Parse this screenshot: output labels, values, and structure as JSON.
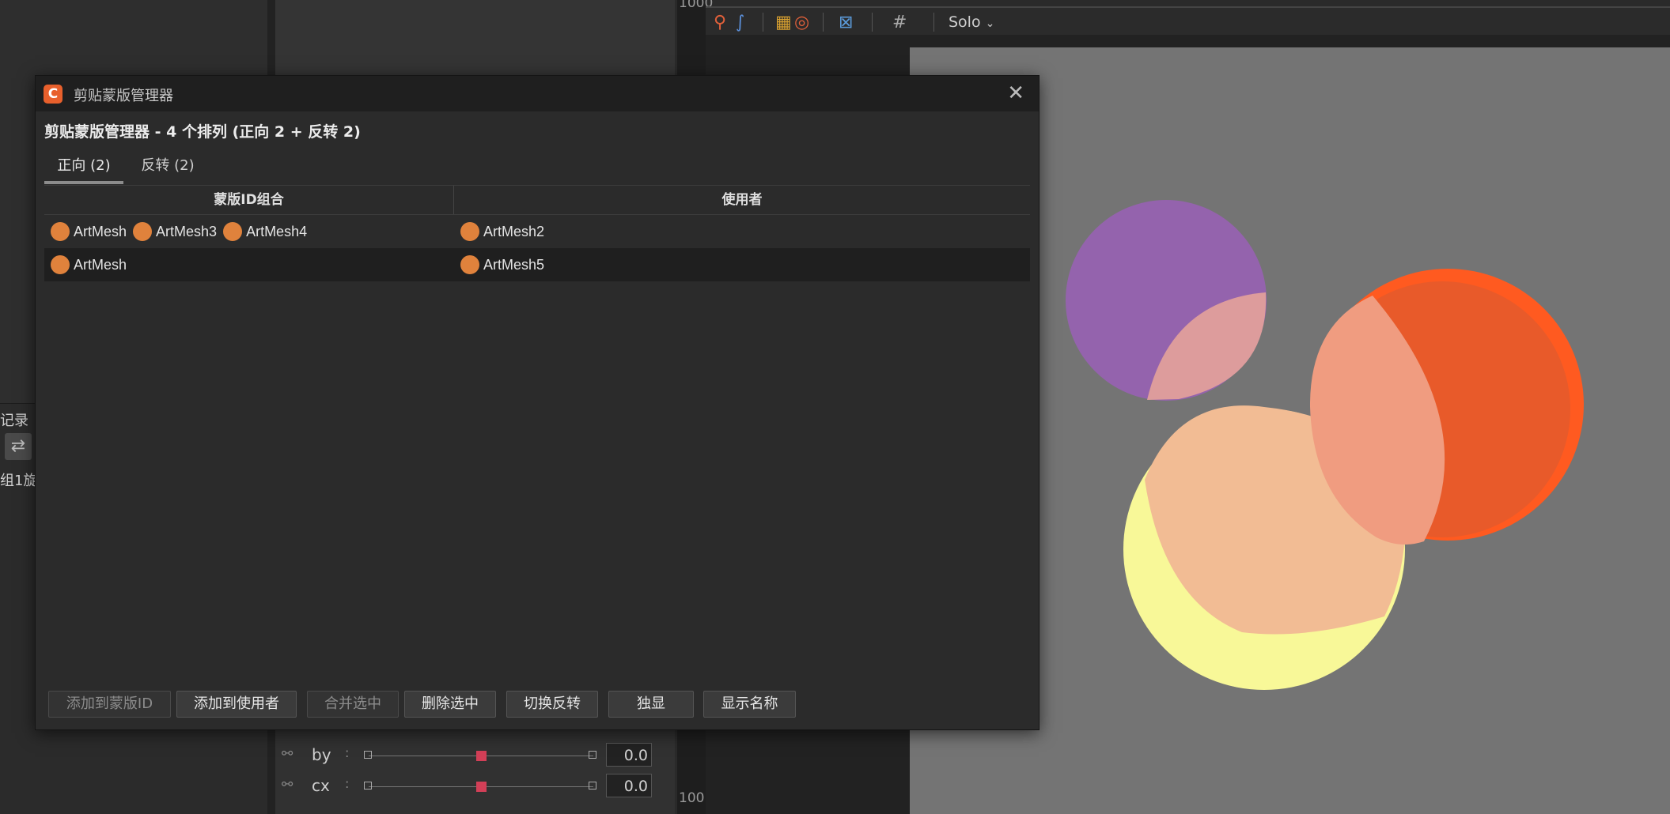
{
  "background": {
    "left_labels": [
      "记录",
      "组1旋"
    ],
    "ruler_labels": [
      "1000",
      "100"
    ],
    "toolbar": {
      "solo_label": "Solo"
    },
    "params": [
      {
        "name": "by",
        "value": "0.0"
      },
      {
        "name": "cx",
        "value": "0.0"
      }
    ]
  },
  "dialog": {
    "title": "剪贴蒙版管理器",
    "heading": "剪贴蒙版管理器 - 4 个排列 (正向 2 + 反转 2)",
    "tabs": [
      {
        "label": "正向 (2)",
        "active": true
      },
      {
        "label": "反转 (2)",
        "active": false
      }
    ],
    "columns": [
      "蒙版ID组合",
      "使用者"
    ],
    "rows": [
      {
        "masks": [
          "ArtMesh",
          "ArtMesh3",
          "ArtMesh4"
        ],
        "users": [
          "ArtMesh2"
        ]
      },
      {
        "masks": [
          "ArtMesh"
        ],
        "users": [
          "ArtMesh5"
        ]
      }
    ],
    "buttons": [
      {
        "label": "添加到蒙版ID",
        "enabled": false
      },
      {
        "label": "添加到使用者",
        "enabled": true
      },
      {
        "label": "合并选中",
        "enabled": false
      },
      {
        "label": "删除选中",
        "enabled": true
      },
      {
        "label": "切换反转",
        "enabled": true
      },
      {
        "label": "独显",
        "enabled": true
      },
      {
        "label": "显示名称",
        "enabled": true
      }
    ]
  },
  "colors": {
    "tag_dot": "#e0823c",
    "accent": "#e8602c",
    "slider_knob": "#d23f57",
    "canvas_bg": "#747474"
  }
}
